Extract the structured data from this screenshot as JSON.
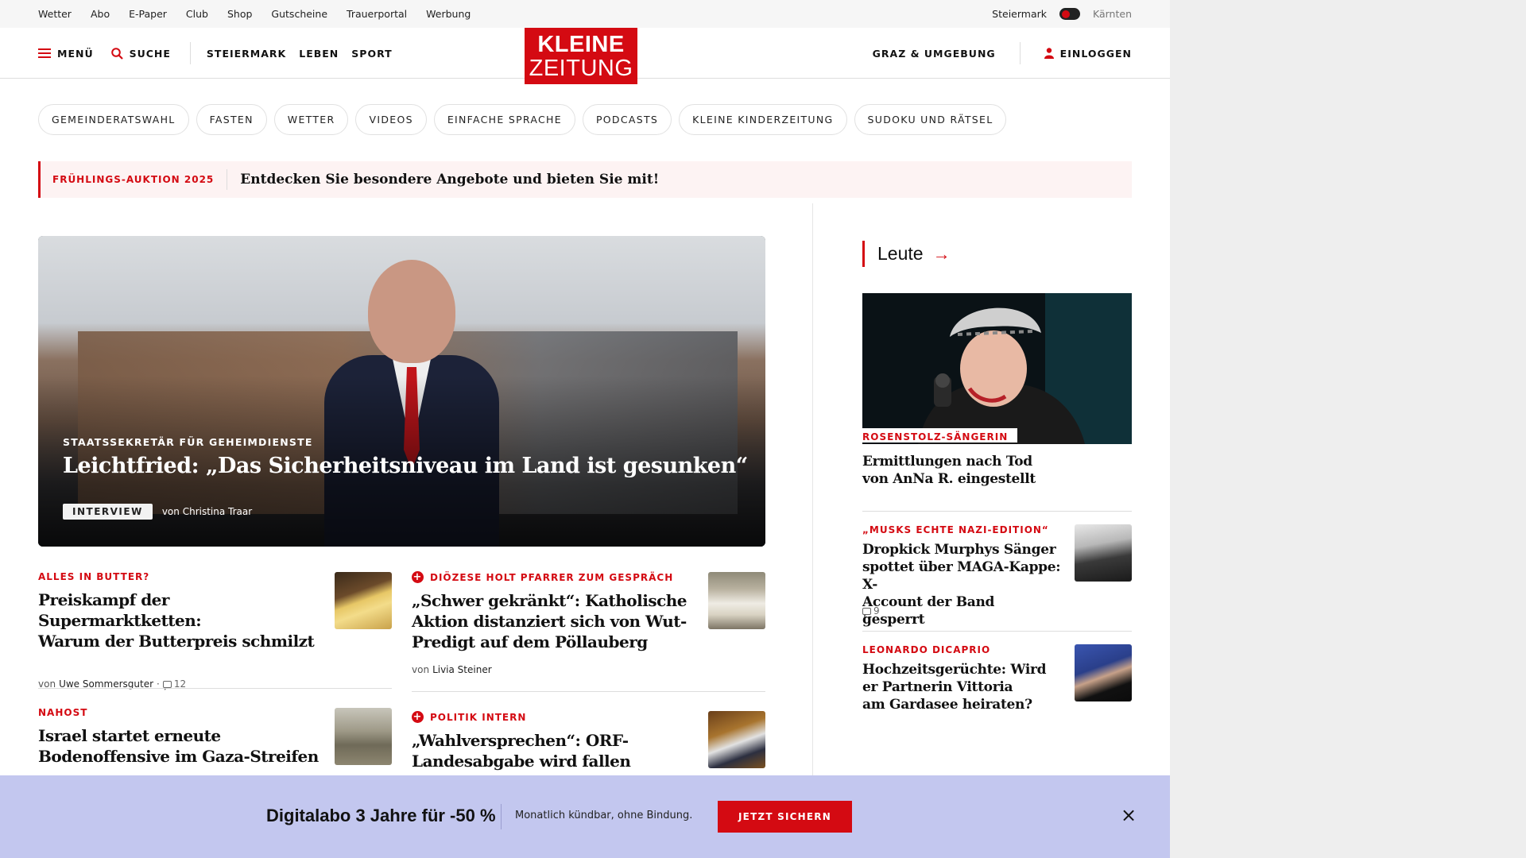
{
  "utilbar": {
    "links": [
      "Wetter",
      "Abo",
      "E-Paper",
      "Club",
      "Shop",
      "Gutscheine",
      "Trauerportal",
      "Werbung"
    ],
    "region_active": "Steiermark",
    "region_inactive": "Kärnten"
  },
  "header": {
    "menu_label": "MENÜ",
    "search_label": "SUCHE",
    "nav": [
      "STEIERMARK",
      "LEBEN",
      "SPORT"
    ],
    "logo_line1": "KLEINE",
    "logo_line2": "ZEITUNG",
    "region_link": "GRAZ & UMGEBUNG",
    "login_label": "EINLOGGEN"
  },
  "chips": [
    "GEMEINDERATSWAHL",
    "FASTEN",
    "WETTER",
    "VIDEOS",
    "EINFACHE SPRACHE",
    "PODCASTS",
    "KLEINE KINDERZEITUNG",
    "SUDOKU UND RÄTSEL"
  ],
  "promo": {
    "tag": "FRÜHLINGS-AUKTION 2025",
    "message": "Entdecken Sie besondere Angebote und bieten Sie mit!"
  },
  "hero": {
    "kicker": "STAATSSEKRETÄR FÜR GEHEIMDIENSTE",
    "title": "Leichtfried: „Das Sicherheitsniveau im Land ist gesunken“",
    "badge": "INTERVIEW",
    "byline_prefix": "von",
    "author": "Christina Traar"
  },
  "articles": [
    {
      "kicker": "ALLES IN BUTTER?",
      "title_lines": [
        "Preiskampf der Supermarktketten:",
        "Warum der Butterpreis schmilzt"
      ],
      "byline_prefix": "von",
      "author": "Uwe Sommersguter",
      "comments": "12",
      "premium": false
    },
    {
      "kicker": "DIÖZESE HOLT PFARRER ZUM GESPRÄCH",
      "title_lines": [
        "„Schwer gekränkt“: Katholische",
        "Aktion distanziert sich von Wut-",
        "Predigt auf dem Pöllauberg"
      ],
      "byline_prefix": "von",
      "author": "Livia Steiner",
      "premium": true
    },
    {
      "kicker": "NAHOST",
      "title_lines": [
        "Israel startet erneute",
        "Bodenoffensive im Gaza-Streifen"
      ],
      "premium": false
    },
    {
      "kicker": "POLITIK INTERN",
      "title_lines": [
        "„Wahlversprechen“: ORF-",
        "Landesabgabe wird fallen"
      ],
      "premium": true
    }
  ],
  "sidebar": {
    "heading": "Leute",
    "lead_caption": "ROSENSTOLZ-SÄNGERIN",
    "lead_title_lines": [
      "Ermittlungen nach Tod",
      "von AnNa R. eingestellt"
    ],
    "items": [
      {
        "kicker": "„MUSKS ECHTE NAZI-EDITION“",
        "title_lines": [
          "Dropkick Murphys Sänger",
          "spottet über MAGA-Kappe: X-",
          "Account der Band gesperrt"
        ],
        "comments": "9"
      },
      {
        "kicker": "LEONARDO DICAPRIO",
        "title_lines": [
          "Hochzeitsgerüchte: Wird",
          "er Partnerin Vittoria",
          "am Gardasee heiraten?"
        ]
      }
    ]
  },
  "banner": {
    "headline": "Digitalabo 3 Jahre für -50 %",
    "subtext": "Monatlich kündbar, ohne Bindung.",
    "cta": "JETZT SICHERN",
    "close": "×"
  },
  "colors": {
    "accent": "#d40a12",
    "banner_bg": "#c3c7ef",
    "promo_bg": "#fdf3f3"
  }
}
